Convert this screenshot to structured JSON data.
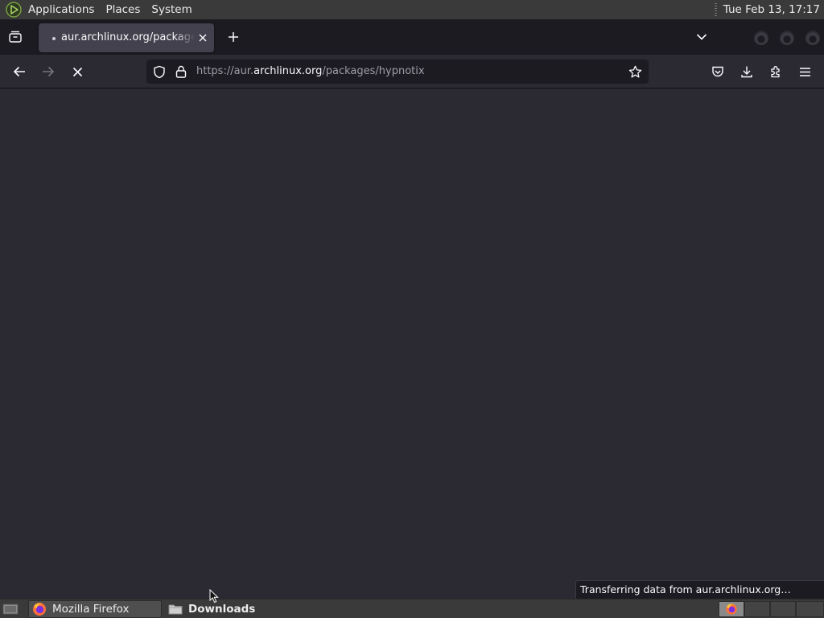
{
  "top_panel": {
    "menus": [
      "Applications",
      "Places",
      "System"
    ],
    "clock": "Tue Feb 13, 17:17"
  },
  "browser": {
    "tab": {
      "title": "aur.archlinux.org/packages/hypnotix",
      "loading": true
    },
    "urlbar": {
      "url_prefix": "https://aur.",
      "url_domain": "archlinux.org",
      "url_path": "/packages/hypnotix"
    },
    "status_text": "Transferring data from aur.archlinux.org…"
  },
  "taskbar": {
    "tasks": [
      "Mozilla Firefox",
      "Downloads"
    ]
  },
  "icons": {
    "distro": "mate-distro-icon",
    "tab_list": "firefox-view-icon",
    "new_tab": "plus-icon",
    "all_tabs": "chevron-down-icon",
    "back": "arrow-left-icon",
    "forward": "arrow-right-icon",
    "stop": "close-icon",
    "tracking": "shield-icon",
    "lock": "lock-icon",
    "bookmark": "star-icon",
    "pocket": "pocket-icon",
    "downloads": "download-icon",
    "extensions": "puzzle-icon",
    "menu": "hamburger-menu-icon"
  },
  "colors": {
    "tab_strip": "#1c1b22",
    "toolbar": "#2b2a33",
    "selected_tab": "#42414d",
    "urlbar": "#1c1b22",
    "panel": "#3a3a3a"
  }
}
